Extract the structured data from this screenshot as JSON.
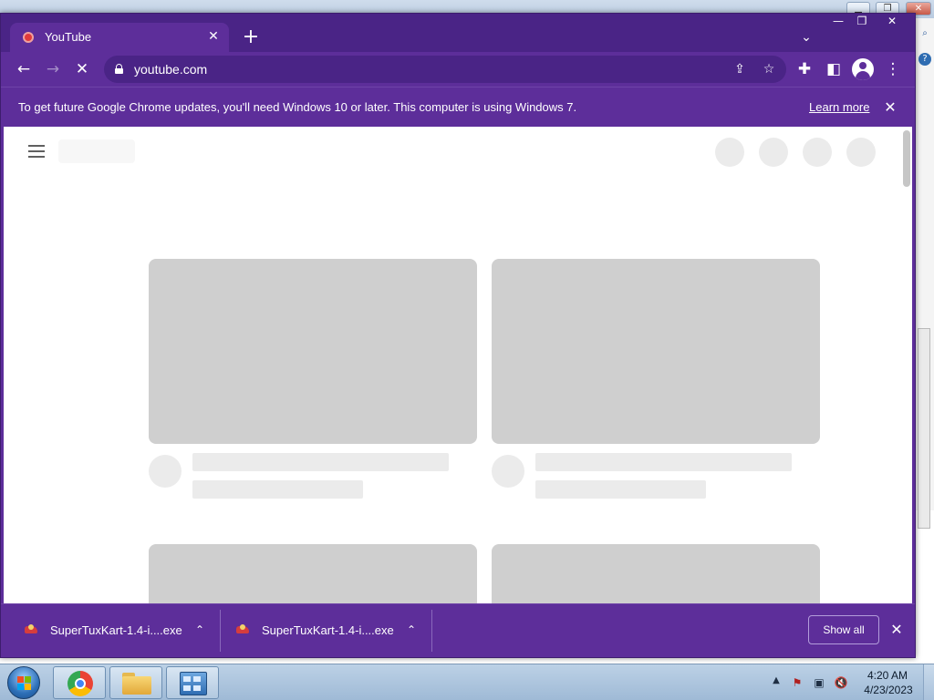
{
  "browser": {
    "tab": {
      "title": "YouTube",
      "close_glyph": "✕",
      "favicon": "youtube-favicon"
    },
    "new_tab_glyph": "+",
    "tab_search_glyph": "⌄",
    "window_controls": {
      "minimize": "—",
      "maximize": "❐",
      "close": "✕"
    },
    "toolbar": {
      "back_glyph": "←",
      "forward_glyph": "→",
      "stop_glyph": "✕",
      "url": "youtube.com",
      "share_glyph": "⇪",
      "bookmark_glyph": "☆",
      "extensions_glyph": "✚",
      "side_panel_glyph": "◧",
      "menu_glyph": "⋮"
    },
    "infobar": {
      "message": "To get future Google Chrome updates, you'll need Windows 10 or later. This computer is using Windows 7.",
      "learn_more": "Learn more",
      "close_glyph": "✕"
    },
    "downloads": {
      "items": [
        {
          "filename": "SuperTuxKart-1.4-i....exe",
          "chevron": "⌃"
        },
        {
          "filename": "SuperTuxKart-1.4-i....exe",
          "chevron": "⌃"
        }
      ],
      "show_all": "Show all",
      "close_glyph": "✕"
    },
    "theme_colors": {
      "frame": "#4a2486",
      "toolbar": "#5d2e9a",
      "skeleton": "#cfcfcf"
    }
  },
  "background_window": {
    "caption_buttons": [
      "▁",
      "❐",
      "✕"
    ],
    "right_icons": [
      "⌕",
      "?"
    ]
  },
  "taskbar": {
    "apps": [
      "start-button",
      "google-chrome",
      "windows-explorer",
      "control-panel"
    ],
    "tray_arrow": "▲",
    "tray_icons": [
      "⚑",
      "▣",
      "🔇"
    ],
    "clock_time": "4:20 AM",
    "clock_date": "4/23/2023"
  }
}
